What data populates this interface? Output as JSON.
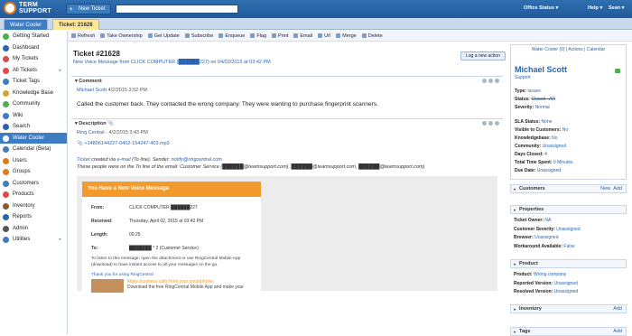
{
  "brand": {
    "line1": "TERM",
    "line2": "SUPPORT",
    "accent": "#e07b1c"
  },
  "header": {
    "new_ticket_label": "New Ticket",
    "search_placeholder": "",
    "office_status": "Office Status",
    "help": "Help",
    "user": "Sean"
  },
  "tabs": [
    {
      "label": "Water Cooler"
    },
    {
      "label": "Ticket: 21628"
    }
  ],
  "toolbar": [
    "Refresh",
    "Take Ownership",
    "Get Update",
    "Subscribe",
    "Enqueue",
    "Flag",
    "Print",
    "Email",
    "Url",
    "Merge",
    "Delete"
  ],
  "sidebar": [
    {
      "label": "Getting Started",
      "icon": "green-circle-icon",
      "color": "#4caf50"
    },
    {
      "label": "Dashboard",
      "icon": "dashboard-icon",
      "color": "#2a64b0"
    },
    {
      "label": "My Tickets",
      "icon": "ticket-icon",
      "color": "#e04a4a"
    },
    {
      "label": "All Tickets",
      "icon": "tickets-icon",
      "color": "#e04a4a",
      "arrow": "▸"
    },
    {
      "label": "Ticket Tags",
      "icon": "tag-icon",
      "color": "#3d7dc3"
    },
    {
      "label": "Knowledge Base",
      "icon": "book-icon",
      "color": "#d9a03a"
    },
    {
      "label": "Community",
      "icon": "community-icon",
      "color": "#4caf50"
    },
    {
      "label": "Wiki",
      "icon": "wiki-icon",
      "color": "#3d7dc3"
    },
    {
      "label": "Search",
      "icon": "search-icon",
      "color": "#2a64b0"
    },
    {
      "label": "Water Cooler",
      "icon": "water-cooler-icon",
      "color": "#ffffff",
      "active": true
    },
    {
      "label": "Calendar (Beta)",
      "icon": "calendar-icon",
      "color": "#3d7dc3"
    },
    {
      "label": "Users",
      "icon": "users-icon",
      "color": "#e07b1c"
    },
    {
      "label": "Groups",
      "icon": "groups-icon",
      "color": "#e07b1c"
    },
    {
      "label": "Customers",
      "icon": "customers-icon",
      "color": "#3d7dc3"
    },
    {
      "label": "Products",
      "icon": "products-icon",
      "color": "#e04a4a"
    },
    {
      "label": "Inventory",
      "icon": "inventory-icon",
      "color": "#8a5a2b"
    },
    {
      "label": "Reports",
      "icon": "reports-icon",
      "color": "#2a64b0"
    },
    {
      "label": "Admin",
      "icon": "admin-icon",
      "color": "#555555"
    },
    {
      "label": "Utilities",
      "icon": "utilities-icon",
      "color": "#3d7dc3",
      "arrow": "▸"
    }
  ],
  "ticket": {
    "title": "Ticket #21628",
    "subtitle": "New Voice Message from CLICK COMPUTER (██████227) on 04/02/2015 at 03:42 PM",
    "new_action_label": "Log a new action"
  },
  "comment": {
    "header": "Comment",
    "author": "Michael Scott",
    "timestamp": "4/2/2015 3:52 PM",
    "text": "Called the customer back.  They contacted the wrong company.  They were wanting to purchase fingerprint scanners."
  },
  "description": {
    "header": "Description",
    "author": "Ring Central",
    "timestamp": "4/2/2015 3:43 PM",
    "attachment": "+14806144227-0402-154247-403.mp3",
    "line1_link": "Ticket",
    "line1_text": " created via ",
    "line1_email": "e-mail",
    "line1_rest": " (To line). Sender: ",
    "line1_sender": "notify@ringcentral.com",
    "line2": "These people were on the To line of the email: Customer Service (██████@teamsupport.com), ██████@teamsupport.com, ██████@teamsupport.com)"
  },
  "email": {
    "header": "You Have a New Voice Message",
    "from_label": "From:",
    "from_value": "CLICK COMPUTER ██████227",
    "received_label": "Received:",
    "received_value": "Thursday, April 02, 2015 at 03:42 PM",
    "length_label": "Length:",
    "length_value": "00:25",
    "to_label": "To:",
    "to_value": "███████ * 2 (Customer Service)",
    "listen_text": "To listen to this message, open the attachment or use RingCentral Mobile App (download) to have instant access to all your messages on the go.",
    "thanks": "Thank you for using RingCentral",
    "promo_line1": "Make business calls from your smartphone",
    "promo_line2": "Download the free RingCentral Mobile App and make your"
  },
  "right": {
    "top_links": "Water Cooler (0) | Actions | Calendar",
    "person": "Michael Scott",
    "role": "Support",
    "fields": [
      {
        "k": "Type:",
        "v": "Issues"
      },
      {
        "k": "Status:",
        "v": "Closed - AR",
        "strike": true
      },
      {
        "k": "Severity:",
        "v": "Normal"
      },
      {
        "k": "SLA Status:",
        "v": "None"
      },
      {
        "k": "Visible to Customers:",
        "v": "No"
      },
      {
        "k": "Knowledgebase:",
        "v": "No"
      },
      {
        "k": "Community:",
        "v": "Unassigned"
      },
      {
        "k": "Days Closed:",
        "v": "4"
      },
      {
        "k": "Total Time Spent:",
        "v": "0 Minutes"
      },
      {
        "k": "Due Date:",
        "v": "Unassigned"
      }
    ],
    "customers": {
      "title": "Customers",
      "new": "New",
      "add": "Add"
    },
    "properties": {
      "title": "Properties",
      "fields": [
        {
          "k": "Ticket Owner:",
          "v": "NA"
        },
        {
          "k": "Customer Severity:",
          "v": "Unassigned"
        },
        {
          "k": "Browser:",
          "v": "Unassigned"
        },
        {
          "k": "Workaround Available:",
          "v": "False"
        }
      ]
    },
    "product": {
      "title": "Product",
      "fields": [
        {
          "k": "Product:",
          "v": "Wrong company"
        },
        {
          "k": "Reported Version:",
          "v": "Unassigned"
        },
        {
          "k": "Resolved Version:",
          "v": "Unassigned"
        }
      ]
    },
    "inventory": {
      "title": "Inventory",
      "add": "Add"
    },
    "tags": {
      "title": "Tags",
      "add": "Add"
    }
  }
}
